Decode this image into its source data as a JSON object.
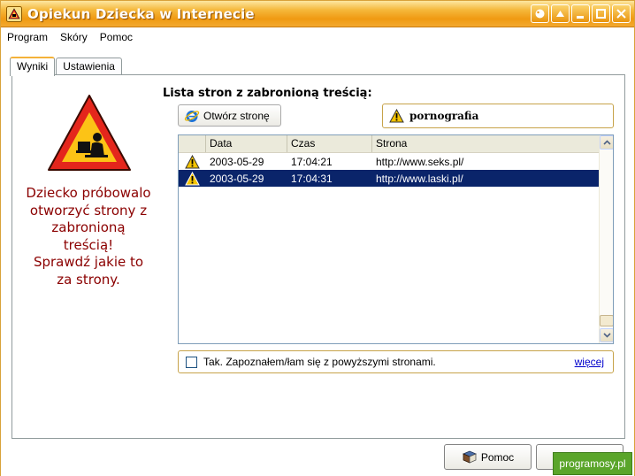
{
  "window": {
    "title": "Opiekun Dziecka w Internecie"
  },
  "menu": [
    "Program",
    "Skóry",
    "Pomoc"
  ],
  "tabs": [
    {
      "label": "Wyniki",
      "active": true
    },
    {
      "label": "Ustawienia",
      "active": false
    }
  ],
  "warning": {
    "message_lines": [
      "Dziecko próbowalo",
      "otworzyć strony z",
      "zabronioną",
      "treścią!",
      "Sprawdź jakie to",
      "za strony."
    ]
  },
  "list": {
    "title": "Lista stron z zabronioną treścią:",
    "open_button": "Otwórz stronę",
    "category": "pornografia",
    "columns": [
      "",
      "Data",
      "Czas",
      "Strona"
    ],
    "rows": [
      {
        "date": "2003-05-29",
        "time": "17:04:21",
        "url": "http://www.seks.pl/",
        "selected": false
      },
      {
        "date": "2003-05-29",
        "time": "17:04:31",
        "url": "http://www.laski.pl/",
        "selected": true
      }
    ]
  },
  "ack": {
    "label": "Tak. Zapoznałem/łam się z powyższymi stronami.",
    "more_link": "więcej",
    "checked": false
  },
  "footer": {
    "help_button": "Pomoc",
    "watermark": "programosy.pl"
  },
  "colors": {
    "title_orange": "#f09a12",
    "message_red": "#8b0000",
    "selection": "#0a246a"
  }
}
